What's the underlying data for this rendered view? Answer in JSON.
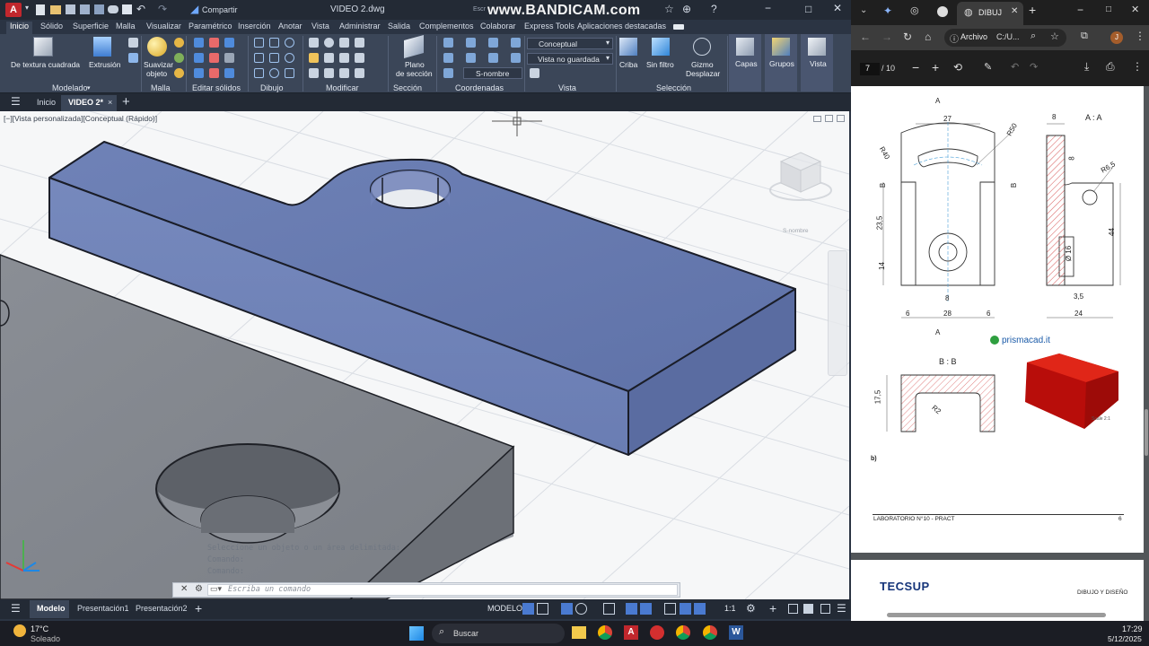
{
  "autocad": {
    "title_bar": {
      "share_label": "Compartir",
      "file_name": "VIDEO 2.dwg",
      "watermark": "www.BANDICAM.com",
      "watermark_prefix": "Escr"
    },
    "ribbon_tabs": [
      "Inicio",
      "Sólido",
      "Superficie",
      "Malla",
      "Visualizar",
      "Paramétrico",
      "Inserción",
      "Anotar",
      "Vista",
      "Administrar",
      "Salida",
      "Complementos",
      "Colaborar",
      "Express Tools",
      "Aplicaciones destacadas"
    ],
    "ribbon": {
      "btn_de_textura": "De textura cuadrada",
      "btn_extrusion": "Extrusión",
      "btn_suavizar_1": "Suavizar",
      "btn_suavizar_2": "objeto",
      "btn_plano_1": "Plano",
      "btn_plano_2": "de sección",
      "visual_style": "Conceptual",
      "view_saved": "Vista no guardada",
      "ucs_name": "S-nombre",
      "btn_criba": "Criba",
      "btn_sin_filtro": "Sin filtro",
      "btn_gizmo_1": "Gizmo",
      "btn_gizmo_2": "Desplazar",
      "btn_capas": "Capas",
      "btn_grupos": "Grupos",
      "btn_vista": "Vista",
      "panels": [
        "Modelado",
        "Malla",
        "Editar sólidos",
        "Dibujo",
        "Modificar",
        "Sección",
        "Coordenadas",
        "Vista",
        "Selección"
      ]
    },
    "doc_tabs": {
      "start": "Inicio",
      "active": "VIDEO 2*"
    },
    "viewport": {
      "label": "[−][Vista personalizada][Conceptual (Rápido)]",
      "viewcube_label": "S-nombre"
    },
    "command_line": {
      "history": [
        "Seleccione un objeto o un área delimitada:",
        "Comando:",
        "Comando:"
      ],
      "placeholder": "Escriba un comando"
    },
    "status_bar": {
      "tabs": [
        "Modelo",
        "Presentación1",
        "Presentación2"
      ],
      "mode": "MODELO",
      "scale": "1:1"
    }
  },
  "browser": {
    "tab_title": "DIBUJ",
    "address_label": "Archivo",
    "address": "C:/U...",
    "page_current": "7",
    "page_total": "/ 10",
    "drawing": {
      "section_aa": "A : A",
      "section_bb": "B : B",
      "label_a": "A",
      "label_b": "B",
      "dims": [
        "27",
        "R50",
        "R40",
        "23,5",
        "14",
        "8",
        "28",
        "6",
        "6",
        "8",
        "R6,5",
        "44",
        "Ø 16",
        "3,5",
        "24",
        "8",
        "17,5",
        "R2"
      ],
      "brand": "prismacad.it",
      "scale_note": "Scale 2:1",
      "item_letter": "b)",
      "footer_left": "LABORATORIO N°10 - PRACT",
      "footer_page": "6",
      "logo": "TECSUP",
      "footer_right": "DIBUJO Y DISEÑO"
    }
  },
  "taskbar": {
    "temp": "17°C",
    "weather": "Soleado",
    "search": "Buscar",
    "time": "17:29",
    "date": "5/12/2025"
  },
  "colors": {
    "accent_blue": "#6a7fb3",
    "autocad_red": "#c1272d",
    "red_part": "#d8140e"
  }
}
